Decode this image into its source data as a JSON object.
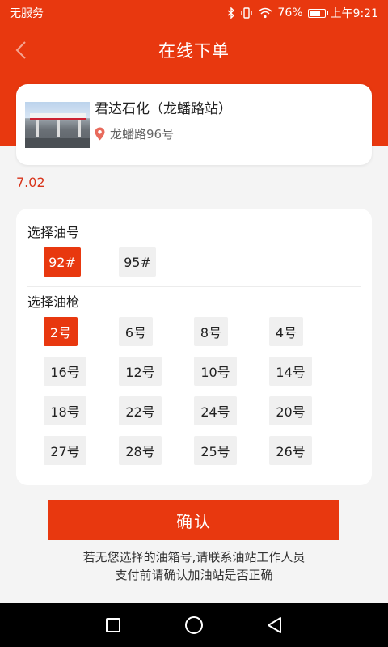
{
  "status_bar": {
    "carrier": "无服务",
    "battery": "76%",
    "battery_level": 0.76,
    "time": "上午9:21"
  },
  "header": {
    "title": "在线下单"
  },
  "station": {
    "name": "君达石化（龙蟠路站）",
    "address": "龙蟠路96号"
  },
  "price": "7.02",
  "fuel": {
    "label": "选择油号",
    "options": [
      "92#",
      "95#"
    ],
    "selected": "92#"
  },
  "nozzle": {
    "label": "选择油枪",
    "options": [
      "2号",
      "6号",
      "8号",
      "4号",
      "16号",
      "12号",
      "10号",
      "14号",
      "18号",
      "22号",
      "24号",
      "20号",
      "27号",
      "28号",
      "25号",
      "26号"
    ],
    "selected": "2号"
  },
  "confirm_label": "确认",
  "notes": [
    "若无您选择的油箱号,请联系油站工作人员",
    "支付前请确认加油站是否正确"
  ],
  "colors": {
    "accent": "#e8380f",
    "price": "#d8341b"
  }
}
